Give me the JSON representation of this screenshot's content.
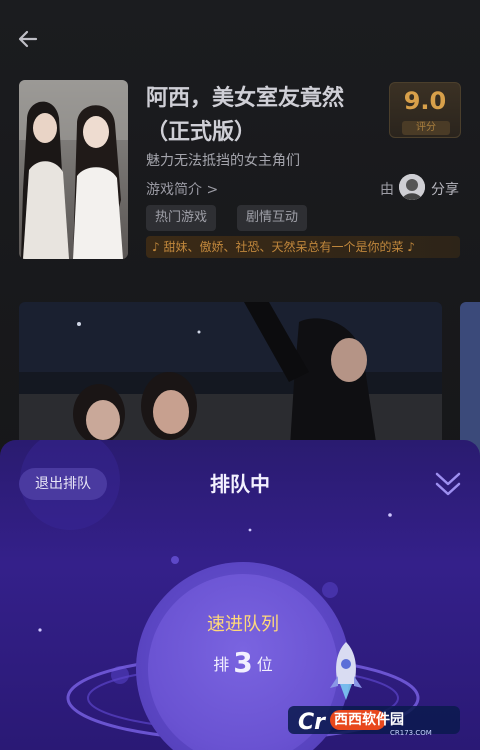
{
  "header": {
    "back_icon": "arrow-left-icon"
  },
  "game": {
    "title": "阿西，美女室友竟然（正式版）",
    "tagline": "魅力无法抵挡的女主角们",
    "intro_link": "游戏简介 >",
    "score": "9.0",
    "score_label": "评分",
    "share_prefix": "由",
    "share_label": "分享",
    "tags": [
      "热门游戏",
      "剧情互动"
    ],
    "promo": "♪ 甜妹、傲娇、社恐、天然呆总有一个是你的菜 ♪"
  },
  "queue": {
    "exit_label": "退出排队",
    "title": "排队中",
    "collapse_icon": "double-chevron-down-icon",
    "speed_label": "速进队列",
    "rank_prefix": "排",
    "rank_number": "3",
    "rank_suffix": "位"
  },
  "watermark": {
    "text": "西西软件园",
    "sub": "CR173.COM"
  },
  "colors": {
    "accent": "#d8a04a",
    "panel": "#34208a",
    "promo_text": "#c0873c",
    "speed_text": "#ffd97a"
  }
}
